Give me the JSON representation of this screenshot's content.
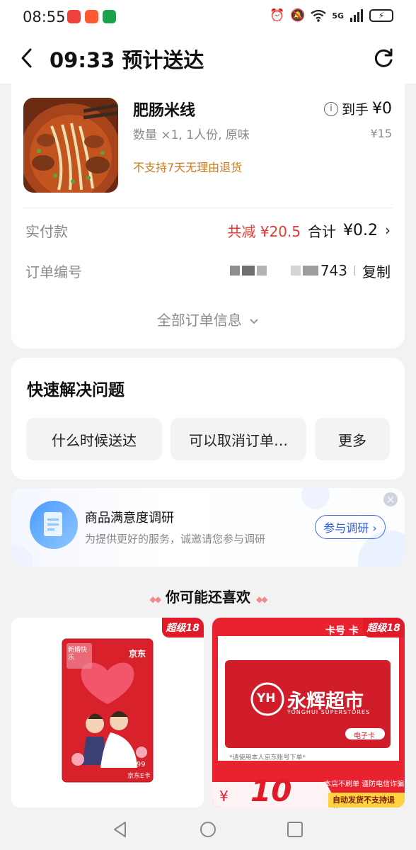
{
  "status_bar": {
    "time": "08:55",
    "network_label": "5G",
    "battery_icon": "battery-charging-icon"
  },
  "header": {
    "title": "09:33 预计送达",
    "back_icon": "chevron-left-icon",
    "refresh_icon": "refresh-icon"
  },
  "order": {
    "product_name": "肥肠米线",
    "product_spec": "数量 ×1, 1人份, 原味",
    "product_warning": "不支持7天无理由退货",
    "final_price_label": "到手",
    "final_price": "¥0",
    "original_price": "¥15",
    "paid_label": "实付款",
    "discount": "共减 ¥20.5",
    "total_label": "合计",
    "total_value": "¥0.2",
    "order_no_label": "订单编号",
    "order_no_suffix": "743",
    "copy_label": "复制",
    "all_info_label": "全部订单信息"
  },
  "quick": {
    "title": "快速解决问题",
    "chips": [
      "什么时候送达",
      "可以取消订单…",
      "更多"
    ]
  },
  "survey": {
    "title": "商品满意度调研",
    "subtitle": "为提供更好的服务，诚邀请您参与调研",
    "button": "参与调研 ›",
    "close": "×"
  },
  "recommend": {
    "title": "你可能还喜欢",
    "items": [
      {
        "tag": "超级18",
        "card_brand": "京东",
        "card_corner_text": "新婚快乐",
        "card_value": "¥999",
        "card_label": "京东E卡"
      },
      {
        "tag": "超级18",
        "top_text": "卡号 卡",
        "brand_mark": "YH",
        "brand_cn": "永辉超市",
        "brand_en": "YONGHUI SUPERSTORES",
        "ecard": "电子卡",
        "notice": "*请使用本人京东账号下单*",
        "currency": "¥",
        "price": "10",
        "badge_1": "本店不刷单 谨防电信诈骗",
        "badge_2": "自动发货不支持退换"
      }
    ]
  },
  "colors": {
    "accent_red": "#e83a2f",
    "warning_orange": "#c97a1a",
    "survey_blue": "#2f5de0",
    "tag_red": "#e01a28"
  }
}
